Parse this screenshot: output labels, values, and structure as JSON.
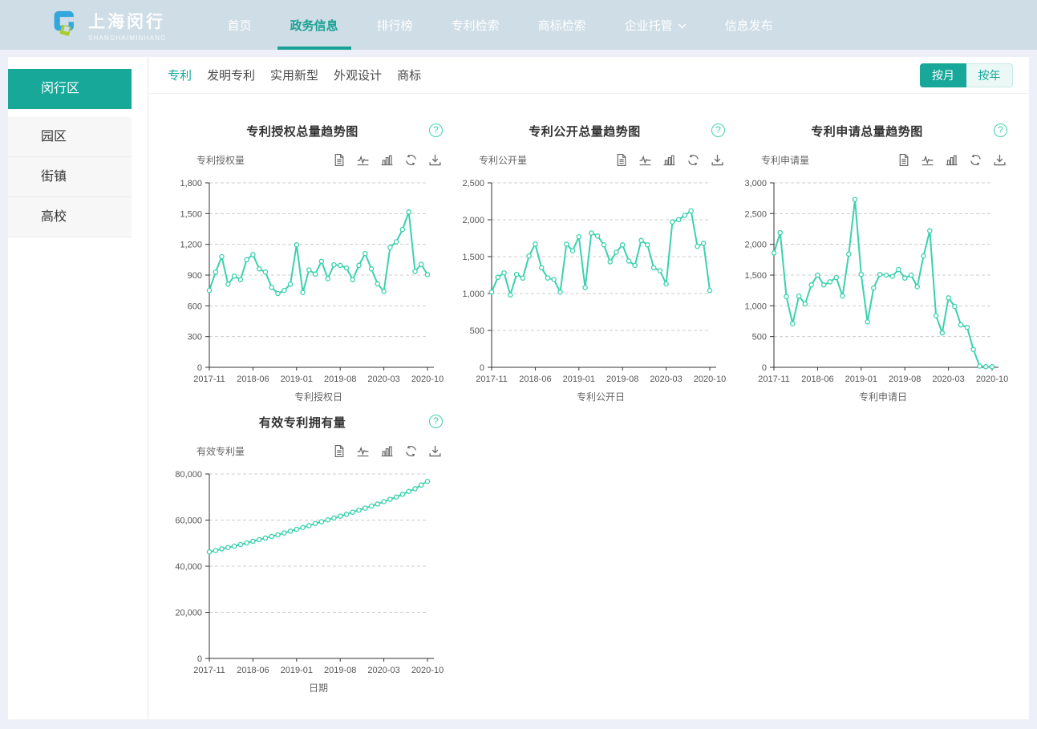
{
  "ui": {
    "help_glyph": "?"
  },
  "colors": {
    "accent": "#17a89a",
    "nav_active": "#18a294",
    "header_bg": "#cfdde6",
    "line": "#3bd1ae",
    "grid": "#cccccc",
    "axis": "#333333"
  },
  "header": {
    "logo": {
      "title": "上海闵行",
      "subtitle": "SHANGHAIMINHANG"
    },
    "nav": [
      {
        "label": "首页"
      },
      {
        "label": "政务信息"
      },
      {
        "label": "排行榜"
      },
      {
        "label": "专利检索"
      },
      {
        "label": "商标检索"
      },
      {
        "label": "企业托管"
      },
      {
        "label": "信息发布"
      }
    ]
  },
  "sidebar": {
    "items": [
      {
        "label": "闵行区",
        "active": true
      },
      {
        "label": "园区"
      },
      {
        "label": "街镇"
      },
      {
        "label": "高校"
      }
    ]
  },
  "tabs": [
    {
      "label": "专利",
      "active": true
    },
    {
      "label": "发明专利"
    },
    {
      "label": "实用新型"
    },
    {
      "label": "外观设计"
    },
    {
      "label": "商标"
    }
  ],
  "period_toggle": {
    "month_label": "按月",
    "year_label": "按年",
    "selected": "按月"
  },
  "toolbox": [
    "data-view",
    "line-chart",
    "bar-chart",
    "refresh",
    "download"
  ],
  "chart_data": [
    {
      "type": "line",
      "title": "专利授权总量趋势图",
      "ylabel": "专利授权量",
      "xlabel": "专利授权日",
      "ylim": [
        0,
        1800
      ],
      "y_step": 300,
      "grid": "dashed",
      "x_tick_labels": [
        "2017-11",
        "2018-06",
        "2019-01",
        "2019-08",
        "2020-03",
        "2020-10"
      ],
      "categories": [
        "2017-11",
        "2017-12",
        "2018-01",
        "2018-02",
        "2018-03",
        "2018-04",
        "2018-05",
        "2018-06",
        "2018-07",
        "2018-08",
        "2018-09",
        "2018-10",
        "2018-11",
        "2018-12",
        "2019-01",
        "2019-02",
        "2019-03",
        "2019-04",
        "2019-05",
        "2019-06",
        "2019-07",
        "2019-08",
        "2019-09",
        "2019-10",
        "2019-11",
        "2019-12",
        "2020-01",
        "2020-02",
        "2020-03",
        "2020-04",
        "2020-05",
        "2020-06",
        "2020-07",
        "2020-08",
        "2020-09",
        "2020-10"
      ],
      "values": [
        750,
        930,
        1080,
        810,
        890,
        855,
        1050,
        1100,
        960,
        930,
        780,
        720,
        750,
        810,
        1195,
        730,
        950,
        910,
        1035,
        865,
        1000,
        995,
        970,
        855,
        995,
        1110,
        960,
        815,
        740,
        1170,
        1225,
        1345,
        1515,
        935,
        1005,
        905
      ]
    },
    {
      "type": "line",
      "title": "专利公开总量趋势图",
      "ylabel": "专利公开量",
      "xlabel": "专利公开日",
      "ylim": [
        0,
        2500
      ],
      "y_step": 500,
      "grid": "dashed",
      "x_tick_labels": [
        "2017-11",
        "2018-06",
        "2019-01",
        "2019-08",
        "2020-03",
        "2020-10"
      ],
      "categories": [
        "2017-11",
        "2017-12",
        "2018-01",
        "2018-02",
        "2018-03",
        "2018-04",
        "2018-05",
        "2018-06",
        "2018-07",
        "2018-08",
        "2018-09",
        "2018-10",
        "2018-11",
        "2018-12",
        "2019-01",
        "2019-02",
        "2019-03",
        "2019-04",
        "2019-05",
        "2019-06",
        "2019-07",
        "2019-08",
        "2019-09",
        "2019-10",
        "2019-11",
        "2019-12",
        "2020-01",
        "2020-02",
        "2020-03",
        "2020-04",
        "2020-05",
        "2020-06",
        "2020-07",
        "2020-08",
        "2020-09",
        "2020-10"
      ],
      "values": [
        1020,
        1220,
        1280,
        980,
        1260,
        1210,
        1510,
        1670,
        1350,
        1210,
        1190,
        1020,
        1670,
        1580,
        1770,
        1080,
        1820,
        1780,
        1660,
        1430,
        1560,
        1660,
        1440,
        1380,
        1720,
        1660,
        1350,
        1310,
        1130,
        1970,
        2000,
        2060,
        2120,
        1640,
        1680,
        1040
      ]
    },
    {
      "type": "line",
      "title": "专利申请总量趋势图",
      "ylabel": "专利申请量",
      "xlabel": "专利申请日",
      "ylim": [
        0,
        3000
      ],
      "y_step": 500,
      "grid": "dashed",
      "x_tick_labels": [
        "2017-11",
        "2018-06",
        "2019-01",
        "2019-08",
        "2020-03",
        "2020-10"
      ],
      "categories": [
        "2017-11",
        "2017-12",
        "2018-01",
        "2018-02",
        "2018-03",
        "2018-04",
        "2018-05",
        "2018-06",
        "2018-07",
        "2018-08",
        "2018-09",
        "2018-10",
        "2018-11",
        "2018-12",
        "2019-01",
        "2019-02",
        "2019-03",
        "2019-04",
        "2019-05",
        "2019-06",
        "2019-07",
        "2019-08",
        "2019-09",
        "2019-10",
        "2019-11",
        "2019-12",
        "2020-01",
        "2020-02",
        "2020-03",
        "2020-04",
        "2020-05",
        "2020-06",
        "2020-07",
        "2020-08",
        "2020-09",
        "2020-10"
      ],
      "values": [
        1860,
        2190,
        1150,
        710,
        1160,
        1030,
        1340,
        1500,
        1340,
        1390,
        1460,
        1160,
        1840,
        2730,
        1510,
        740,
        1290,
        1510,
        1500,
        1480,
        1590,
        1450,
        1500,
        1310,
        1810,
        2220,
        840,
        560,
        1130,
        990,
        690,
        650,
        290,
        20,
        10,
        10
      ]
    },
    {
      "type": "line",
      "title": "有效专利拥有量",
      "ylabel": "有效专利量",
      "xlabel": "日期",
      "ylim": [
        0,
        80000
      ],
      "y_step": 20000,
      "grid": "dashed",
      "x_tick_labels": [
        "2017-11",
        "2018-06",
        "2019-01",
        "2019-08",
        "2020-03",
        "2020-10"
      ],
      "categories": [
        "2017-11",
        "2017-12",
        "2018-01",
        "2018-02",
        "2018-03",
        "2018-04",
        "2018-05",
        "2018-06",
        "2018-07",
        "2018-08",
        "2018-09",
        "2018-10",
        "2018-11",
        "2018-12",
        "2019-01",
        "2019-02",
        "2019-03",
        "2019-04",
        "2019-05",
        "2019-06",
        "2019-07",
        "2019-08",
        "2019-09",
        "2019-10",
        "2019-11",
        "2019-12",
        "2020-01",
        "2020-02",
        "2020-03",
        "2020-04",
        "2020-05",
        "2020-06",
        "2020-07",
        "2020-08",
        "2020-09",
        "2020-10"
      ],
      "values": [
        46200,
        46800,
        47500,
        48100,
        48700,
        49400,
        50100,
        50800,
        51500,
        52200,
        52900,
        53600,
        54400,
        55200,
        56000,
        56800,
        57600,
        58500,
        59300,
        60100,
        60900,
        61700,
        62500,
        63400,
        64300,
        65200,
        66100,
        67000,
        68000,
        69000,
        70000,
        71200,
        72400,
        73600,
        75200,
        76800
      ]
    }
  ]
}
